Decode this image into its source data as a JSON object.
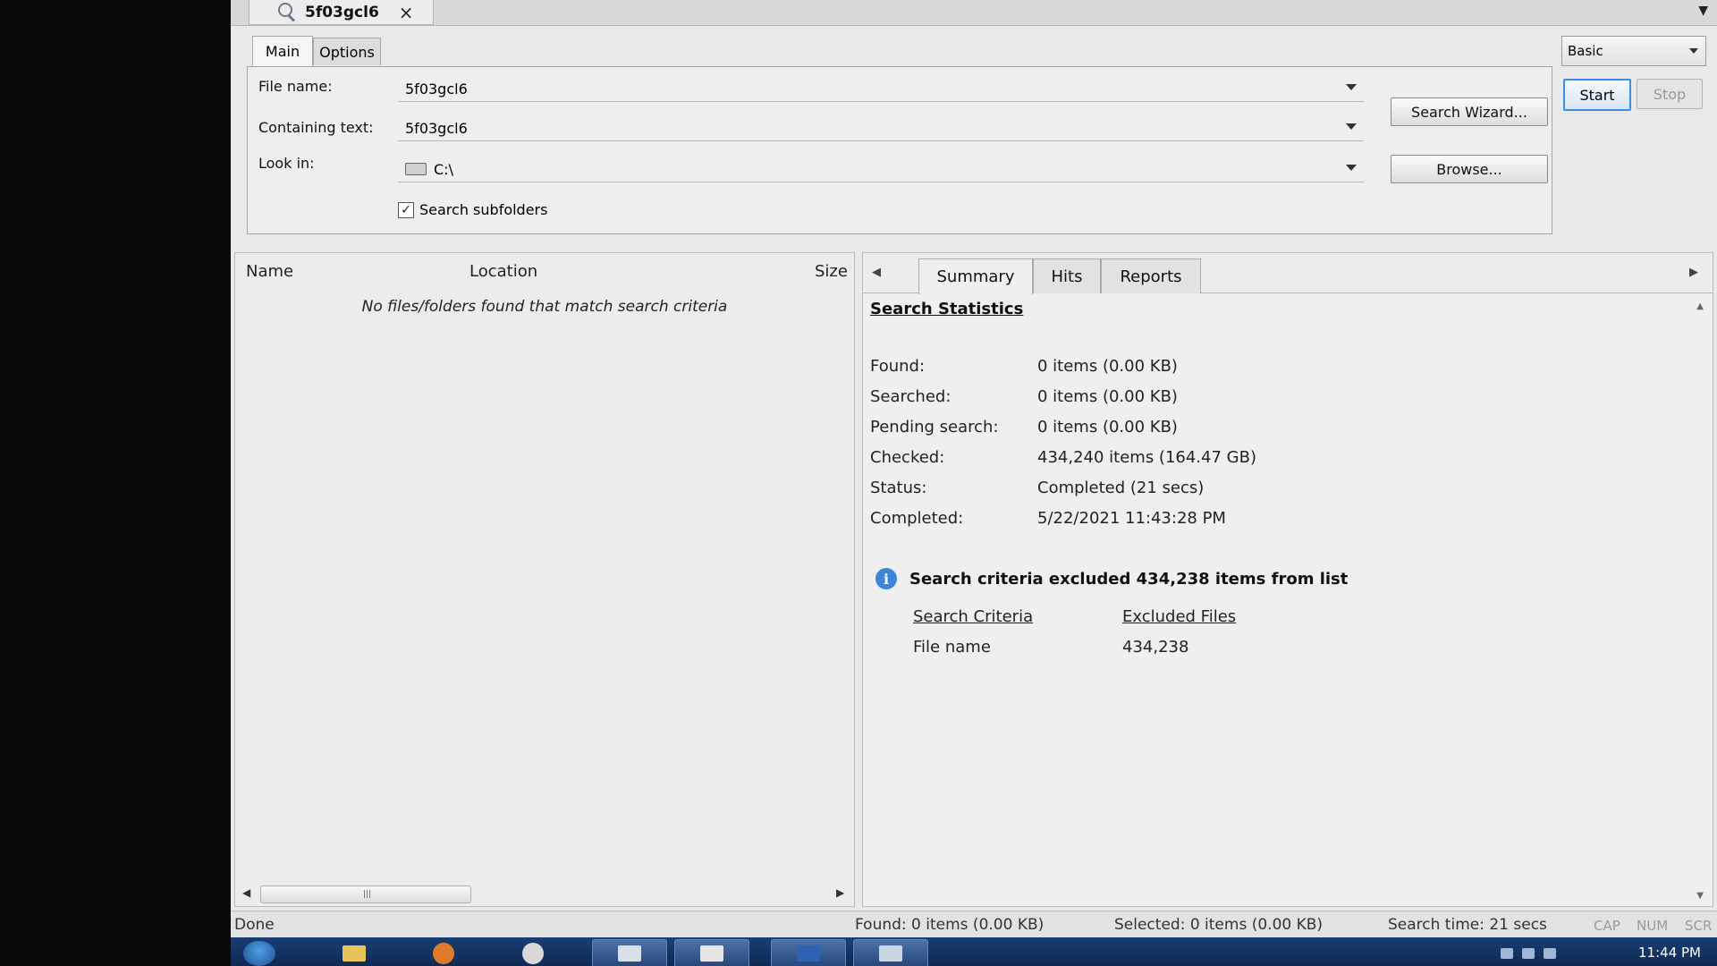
{
  "document_tab": {
    "title": "5f03gcl6",
    "close": "×"
  },
  "criteria": {
    "tabs": {
      "main": "Main",
      "options": "Options"
    },
    "file_name": {
      "label": "File name:",
      "value": "5f03gcl6"
    },
    "containing_text": {
      "label": "Containing text:",
      "value": "5f03gcl6"
    },
    "look_in": {
      "label": "Look in:",
      "value": "C:\\"
    },
    "search_subfolders": {
      "label": "Search subfolders",
      "checked": true,
      "mark": "✓"
    },
    "search_wizard_button": "Search Wizard...",
    "browse_button": "Browse..."
  },
  "mode_select": {
    "value": "Basic"
  },
  "actions": {
    "start": "Start",
    "stop": "Stop"
  },
  "results": {
    "columns": {
      "name": "Name",
      "location": "Location",
      "size": "Size"
    },
    "empty_message": "No files/folders found that match search criteria"
  },
  "details": {
    "tabs": {
      "summary": "Summary",
      "hits": "Hits",
      "reports": "Reports"
    },
    "section_title": "Search Statistics",
    "stats": [
      {
        "label": "Found:",
        "value": "0 items (0.00 KB)"
      },
      {
        "label": "Searched:",
        "value": "0 items (0.00 KB)"
      },
      {
        "label": "Pending search:",
        "value": "0 items (0.00 KB)"
      },
      {
        "label": "Checked:",
        "value": "434,240 items (164.47 GB)"
      },
      {
        "label": "Status:",
        "value": "Completed (21 secs)"
      },
      {
        "label": "Completed:",
        "value": "5/22/2021 11:43:28 PM"
      }
    ],
    "info_message": "Search criteria excluded 434,238 items from list",
    "excluded_table": {
      "headers": {
        "criteria": "Search Criteria",
        "files": "Excluded Files"
      },
      "row": {
        "criteria": "File name",
        "files": "434,238"
      }
    }
  },
  "statusbar": {
    "state": "Done",
    "found": "Found: 0 items (0.00 KB)",
    "selected": "Selected: 0 items (0.00 KB)",
    "search_time": "Search time: 21 secs",
    "cap": "CAP",
    "num": "NUM",
    "scr": "SCR"
  },
  "taskbar": {
    "clock": "11:44 PM"
  },
  "colors": {
    "accent": "#3a8ee8",
    "taskbar": "#14335f",
    "info": "#3b86d6"
  }
}
